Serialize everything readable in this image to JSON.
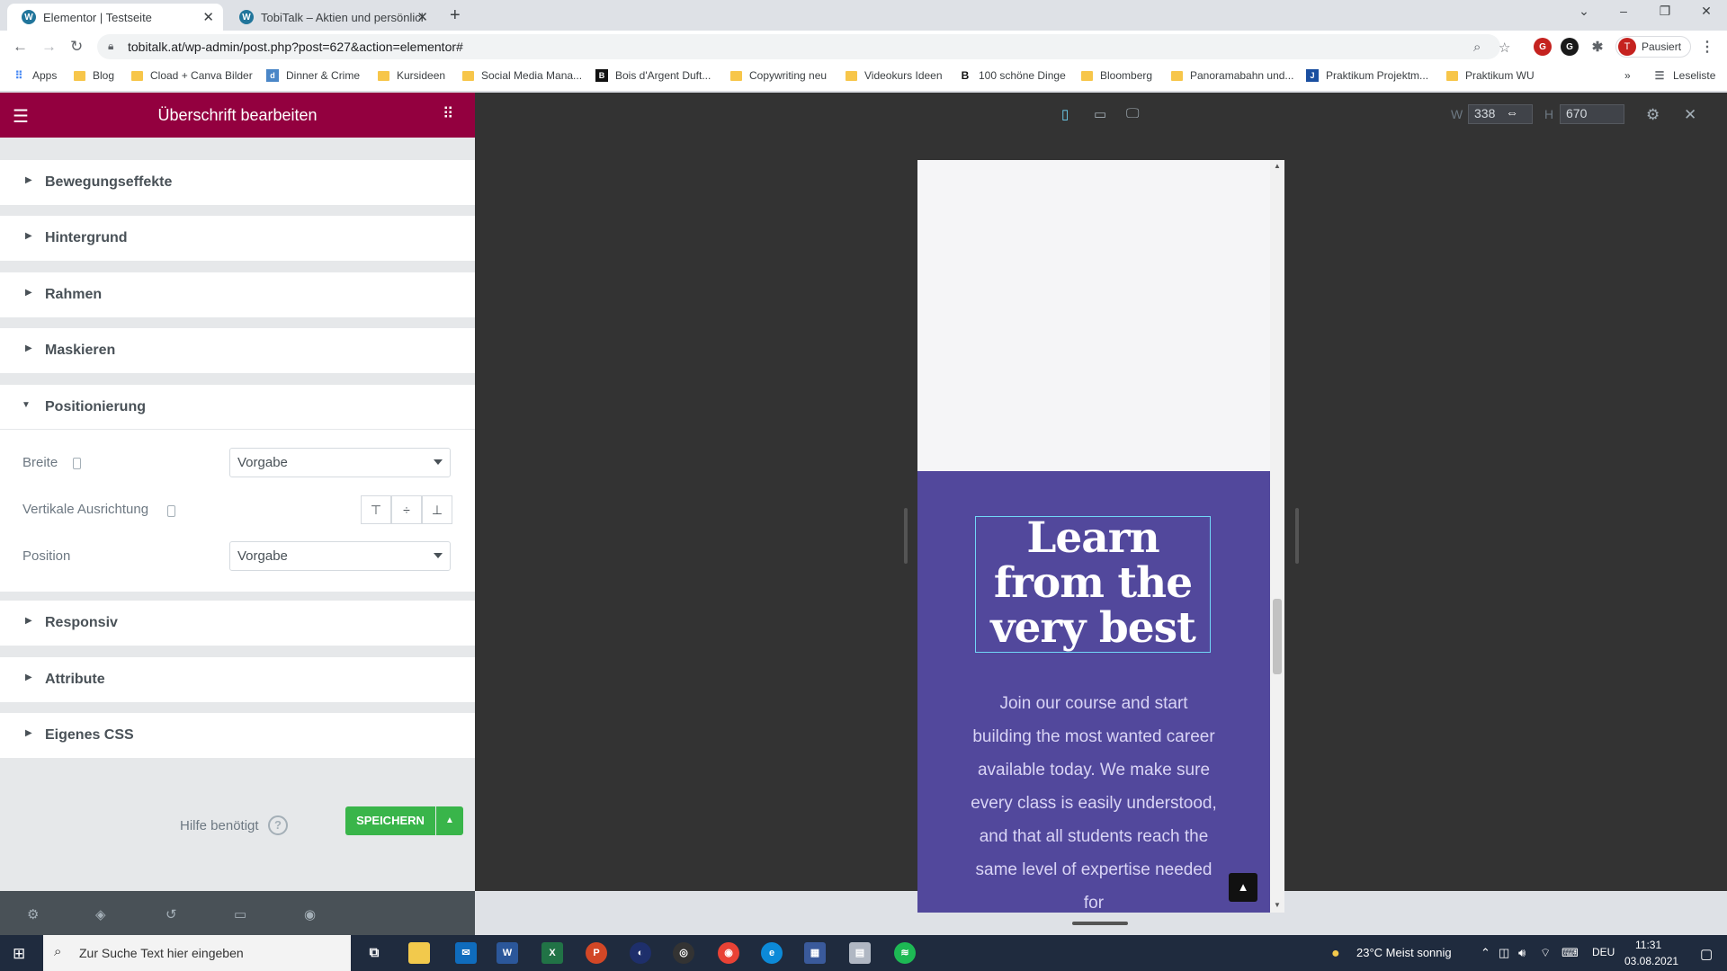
{
  "browser": {
    "tabs": [
      {
        "title": "Elementor | Testseite",
        "active": true
      },
      {
        "title": "TobiTalk – Aktien und persönlich…",
        "active": false
      }
    ],
    "url": "tobitalk.at/wp-admin/post.php?post=627&action=elementor#",
    "profile_initial": "T",
    "profile_label": "Pausiert",
    "bookmarks": [
      "Apps",
      "Blog",
      "Cload + Canva Bilder",
      "Dinner & Crime",
      "Kursideen",
      "Social Media Mana...",
      "Bois d'Argent Duft...",
      "Copywriting neu",
      "Videokurs Ideen",
      "100 schöne Dinge",
      "Bloomberg",
      "Panoramabahn und...",
      "Praktikum Projektm...",
      "Praktikum WU"
    ],
    "reading_list": "Leseliste",
    "more_bookmarks": "»"
  },
  "panel": {
    "title": "Überschrift bearbeiten",
    "sections_top": [
      "Bewegungseffekte",
      "Hintergrund",
      "Rahmen",
      "Maskieren"
    ],
    "open_section": "Positionierung",
    "controls": {
      "breite_label": "Breite",
      "breite_value": "Vorgabe",
      "valign_label": "Vertikale Ausrichtung",
      "position_label": "Position",
      "position_value": "Vorgabe"
    },
    "sections_bottom": [
      "Responsiv",
      "Attribute",
      "Eigenes CSS"
    ],
    "help": "Hilfe benötigt",
    "save": "SPEICHERN"
  },
  "preview": {
    "width_label": "W",
    "width_value": "338",
    "height_label": "H",
    "height_value": "670",
    "heading": "Learn from the very best",
    "text": "Join our course and start building the most wanted career available today. We make sure every class is easily understood, and that all students reach the same level of expertise needed for"
  },
  "taskbar": {
    "search_placeholder": "Zur Suche Text hier eingeben",
    "weather": "23°C  Meist sonnig",
    "lang": "DEU",
    "time": "11:31",
    "date": "03.08.2021"
  },
  "colors": {
    "panel_header": "#93003f",
    "save_button": "#39b54a",
    "hero_bg": "#52489c",
    "preview_bg": "#333333"
  }
}
